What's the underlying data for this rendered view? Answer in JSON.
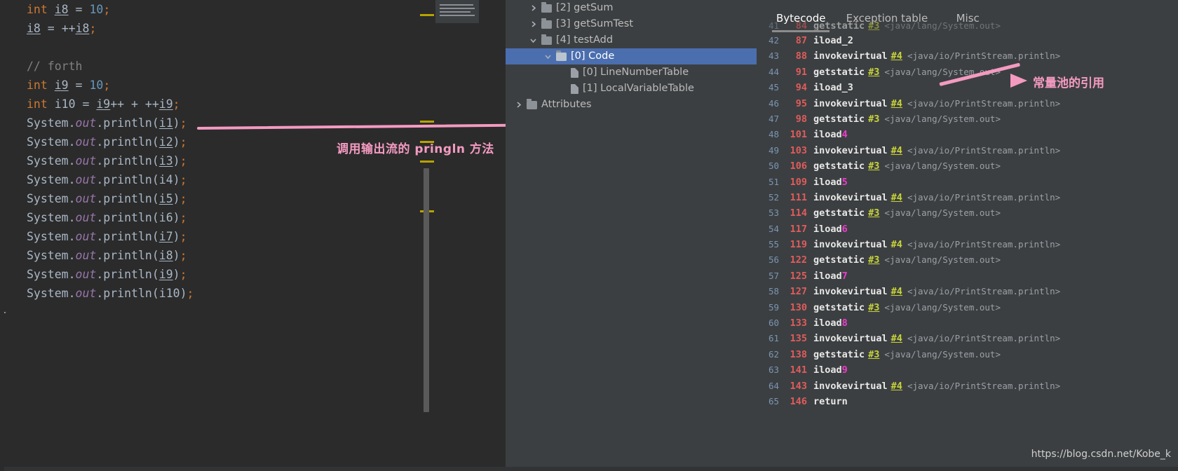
{
  "editor": {
    "lines": [
      {
        "indent": 2,
        "tokens": [
          {
            "t": "int",
            "c": "kw"
          },
          {
            "t": " ",
            "c": "var"
          },
          {
            "t": "i8",
            "c": "var u"
          },
          {
            "t": " = ",
            "c": "var"
          },
          {
            "t": "10",
            "c": "num"
          },
          {
            "t": ";",
            "c": "sc"
          }
        ]
      },
      {
        "indent": 2,
        "tokens": [
          {
            "t": "i8",
            "c": "var u"
          },
          {
            "t": " = ",
            "c": "var"
          },
          {
            "t": "++",
            "c": "var"
          },
          {
            "t": "i8",
            "c": "var u"
          },
          {
            "t": ";",
            "c": "sc"
          }
        ]
      },
      {
        "indent": 2,
        "tokens": []
      },
      {
        "indent": 2,
        "tokens": [
          {
            "t": "// forth",
            "c": "cmt"
          }
        ]
      },
      {
        "indent": 2,
        "tokens": [
          {
            "t": "int",
            "c": "kw"
          },
          {
            "t": " ",
            "c": "var"
          },
          {
            "t": "i9",
            "c": "var u"
          },
          {
            "t": " = ",
            "c": "var"
          },
          {
            "t": "10",
            "c": "num"
          },
          {
            "t": ";",
            "c": "sc"
          }
        ]
      },
      {
        "indent": 2,
        "tokens": [
          {
            "t": "int",
            "c": "kw"
          },
          {
            "t": " i10 = ",
            "c": "var"
          },
          {
            "t": "i9",
            "c": "var u"
          },
          {
            "t": "++ + ++",
            "c": "var"
          },
          {
            "t": "i9",
            "c": "var u"
          },
          {
            "t": ";",
            "c": "sc"
          }
        ]
      },
      {
        "indent": 2,
        "tokens": [
          {
            "t": "System.",
            "c": "var"
          },
          {
            "t": "out",
            "c": "fld"
          },
          {
            "t": ".println(",
            "c": "var"
          },
          {
            "t": "i1",
            "c": "var u"
          },
          {
            "t": ")",
            "c": "var"
          },
          {
            "t": ";",
            "c": "sc"
          }
        ]
      },
      {
        "indent": 2,
        "tokens": [
          {
            "t": "System.",
            "c": "var"
          },
          {
            "t": "out",
            "c": "fld"
          },
          {
            "t": ".println(",
            "c": "var"
          },
          {
            "t": "i2",
            "c": "var u"
          },
          {
            "t": ")",
            "c": "var"
          },
          {
            "t": ";",
            "c": "sc"
          }
        ]
      },
      {
        "indent": 2,
        "tokens": [
          {
            "t": "System.",
            "c": "var"
          },
          {
            "t": "out",
            "c": "fld"
          },
          {
            "t": ".println(",
            "c": "var"
          },
          {
            "t": "i3",
            "c": "var u"
          },
          {
            "t": ")",
            "c": "var"
          },
          {
            "t": ";",
            "c": "sc"
          }
        ]
      },
      {
        "indent": 2,
        "tokens": [
          {
            "t": "System.",
            "c": "var"
          },
          {
            "t": "out",
            "c": "fld"
          },
          {
            "t": ".println(",
            "c": "var"
          },
          {
            "t": "i4",
            "c": "var"
          },
          {
            "t": ")",
            "c": "var"
          },
          {
            "t": ";",
            "c": "sc"
          }
        ]
      },
      {
        "indent": 2,
        "tokens": [
          {
            "t": "System.",
            "c": "var"
          },
          {
            "t": "out",
            "c": "fld"
          },
          {
            "t": ".println(",
            "c": "var"
          },
          {
            "t": "i5",
            "c": "var u"
          },
          {
            "t": ")",
            "c": "var"
          },
          {
            "t": ";",
            "c": "sc"
          }
        ]
      },
      {
        "indent": 2,
        "tokens": [
          {
            "t": "System.",
            "c": "var"
          },
          {
            "t": "out",
            "c": "fld"
          },
          {
            "t": ".println(",
            "c": "var"
          },
          {
            "t": "i6",
            "c": "var"
          },
          {
            "t": ")",
            "c": "var"
          },
          {
            "t": ";",
            "c": "sc"
          }
        ]
      },
      {
        "indent": 2,
        "tokens": [
          {
            "t": "System.",
            "c": "var"
          },
          {
            "t": "out",
            "c": "fld"
          },
          {
            "t": ".println(",
            "c": "var"
          },
          {
            "t": "i7",
            "c": "var u"
          },
          {
            "t": ")",
            "c": "var"
          },
          {
            "t": ";",
            "c": "sc"
          }
        ]
      },
      {
        "indent": 2,
        "tokens": [
          {
            "t": "System.",
            "c": "var"
          },
          {
            "t": "out",
            "c": "fld"
          },
          {
            "t": ".println(",
            "c": "var"
          },
          {
            "t": "i8",
            "c": "var u"
          },
          {
            "t": ")",
            "c": "var"
          },
          {
            "t": ";",
            "c": "sc"
          }
        ]
      },
      {
        "indent": 2,
        "tokens": [
          {
            "t": "System.",
            "c": "var"
          },
          {
            "t": "out",
            "c": "fld"
          },
          {
            "t": ".println(",
            "c": "var"
          },
          {
            "t": "i9",
            "c": "var u"
          },
          {
            "t": ")",
            "c": "var"
          },
          {
            "t": ";",
            "c": "sc"
          }
        ]
      },
      {
        "indent": 2,
        "tokens": [
          {
            "t": "System.",
            "c": "var"
          },
          {
            "t": "out",
            "c": "fld"
          },
          {
            "t": ".println(i10)",
            "c": "var"
          },
          {
            "t": ";",
            "c": "sc"
          }
        ]
      },
      {
        "indent": 0,
        "tokens": [
          {
            "t": "}",
            "c": "brace"
          }
        ]
      }
    ],
    "plain_text": [
      "int i8 = 10;",
      "i8 = ++i8;",
      "",
      "// forth",
      "int i9 = 10;",
      "int i10 = i9++ + ++i9;",
      "System.out.println(i1);",
      "System.out.println(i2);",
      "System.out.println(i3);",
      "System.out.println(i4);",
      "System.out.println(i5);",
      "System.out.println(i6);",
      "System.out.println(i7);",
      "System.out.println(i8);",
      "System.out.println(i9);",
      "System.out.println(i10);",
      "}"
    ],
    "markers": [
      20,
      172,
      201,
      229,
      300
    ],
    "annotation": {
      "label": "调用输出流的 pringln 方法",
      "color": "#f49ac1"
    }
  },
  "tree": {
    "items": [
      {
        "label": "[2] getSum",
        "indent": 1,
        "chevron": "right",
        "icon": "folder-icon",
        "selected": false
      },
      {
        "label": "[3] getSumTest",
        "indent": 1,
        "chevron": "right",
        "icon": "folder-icon",
        "selected": false
      },
      {
        "label": "[4] testAdd",
        "indent": 1,
        "chevron": "down",
        "icon": "folder-icon",
        "selected": false
      },
      {
        "label": "[0] Code",
        "indent": 2,
        "chevron": "down",
        "icon": "folder-icon",
        "selected": true
      },
      {
        "label": "[0] LineNumberTable",
        "indent": 3,
        "chevron": "none",
        "icon": "file-icon",
        "selected": false
      },
      {
        "label": "[1] LocalVariableTable",
        "indent": 3,
        "chevron": "none",
        "icon": "file-icon",
        "selected": false
      },
      {
        "label": "Attributes",
        "indent": 0,
        "chevron": "right",
        "icon": "folder-icon",
        "selected": false
      }
    ]
  },
  "bytecode_panel": {
    "tabs": [
      {
        "label": "Bytecode",
        "active": true
      },
      {
        "label": "Exception table",
        "active": false
      },
      {
        "label": "Misc",
        "active": false
      }
    ],
    "annotation": {
      "label": "常量池的引用",
      "color": "#f49ac1"
    },
    "rows": [
      {
        "line": "42",
        "offset": "87",
        "op": "iload_2",
        "ref": "",
        "ref_underline": false,
        "comment": "",
        "arg": ""
      },
      {
        "line": "43",
        "offset": "88",
        "op": "invokevirtual",
        "ref": "#4",
        "ref_underline": true,
        "comment": "<java/io/PrintStream.println>",
        "arg": ""
      },
      {
        "line": "44",
        "offset": "91",
        "op": "getstatic",
        "ref": "#3",
        "ref_underline": true,
        "comment": "<java/lang/System.out>",
        "arg": ""
      },
      {
        "line": "45",
        "offset": "94",
        "op": "iload_3",
        "ref": "",
        "ref_underline": false,
        "comment": "",
        "arg": ""
      },
      {
        "line": "46",
        "offset": "95",
        "op": "invokevirtual",
        "ref": "#4",
        "ref_underline": true,
        "comment": "<java/io/PrintStream.println>",
        "arg": ""
      },
      {
        "line": "47",
        "offset": "98",
        "op": "getstatic",
        "ref": "#3",
        "ref_underline": false,
        "comment": "<java/lang/System.out>",
        "arg": ""
      },
      {
        "line": "48",
        "offset": "101",
        "op": "iload",
        "ref": "",
        "ref_underline": false,
        "comment": "",
        "arg": "4"
      },
      {
        "line": "49",
        "offset": "103",
        "op": "invokevirtual",
        "ref": "#4",
        "ref_underline": true,
        "comment": "<java/io/PrintStream.println>",
        "arg": ""
      },
      {
        "line": "50",
        "offset": "106",
        "op": "getstatic",
        "ref": "#3",
        "ref_underline": true,
        "comment": "<java/lang/System.out>",
        "arg": ""
      },
      {
        "line": "51",
        "offset": "109",
        "op": "iload",
        "ref": "",
        "ref_underline": false,
        "comment": "",
        "arg": "5"
      },
      {
        "line": "52",
        "offset": "111",
        "op": "invokevirtual",
        "ref": "#4",
        "ref_underline": true,
        "comment": "<java/io/PrintStream.println>",
        "arg": ""
      },
      {
        "line": "53",
        "offset": "114",
        "op": "getstatic",
        "ref": "#3",
        "ref_underline": true,
        "comment": "<java/lang/System.out>",
        "arg": ""
      },
      {
        "line": "54",
        "offset": "117",
        "op": "iload",
        "ref": "",
        "ref_underline": false,
        "comment": "",
        "arg": "6"
      },
      {
        "line": "55",
        "offset": "119",
        "op": "invokevirtual",
        "ref": "#4",
        "ref_underline": false,
        "comment": "<java/io/PrintStream.println>",
        "arg": ""
      },
      {
        "line": "56",
        "offset": "122",
        "op": "getstatic",
        "ref": "#3",
        "ref_underline": true,
        "comment": "<java/lang/System.out>",
        "arg": ""
      },
      {
        "line": "57",
        "offset": "125",
        "op": "iload",
        "ref": "",
        "ref_underline": false,
        "comment": "",
        "arg": "7"
      },
      {
        "line": "58",
        "offset": "127",
        "op": "invokevirtual",
        "ref": "#4",
        "ref_underline": true,
        "comment": "<java/io/PrintStream.println>",
        "arg": ""
      },
      {
        "line": "59",
        "offset": "130",
        "op": "getstatic",
        "ref": "#3",
        "ref_underline": true,
        "comment": "<java/lang/System.out>",
        "arg": ""
      },
      {
        "line": "60",
        "offset": "133",
        "op": "iload",
        "ref": "",
        "ref_underline": false,
        "comment": "",
        "arg": "8"
      },
      {
        "line": "61",
        "offset": "135",
        "op": "invokevirtual",
        "ref": "#4",
        "ref_underline": true,
        "comment": "<java/io/PrintStream.println>",
        "arg": ""
      },
      {
        "line": "62",
        "offset": "138",
        "op": "getstatic",
        "ref": "#3",
        "ref_underline": true,
        "comment": "<java/lang/System.out>",
        "arg": ""
      },
      {
        "line": "63",
        "offset": "141",
        "op": "iload",
        "ref": "",
        "ref_underline": false,
        "comment": "",
        "arg": "9"
      },
      {
        "line": "64",
        "offset": "143",
        "op": "invokevirtual",
        "ref": "#4",
        "ref_underline": true,
        "comment": "<java/io/PrintStream.println>",
        "arg": ""
      },
      {
        "line": "65",
        "offset": "146",
        "op": "return",
        "ref": "",
        "ref_underline": false,
        "comment": "",
        "arg": ""
      }
    ]
  },
  "watermark": {
    "text": "https://blog.csdn.net/Kobe_k"
  },
  "colors": {
    "editor_bg": "#2b2b2b",
    "panel_bg": "#3c3f41",
    "selection": "#4b6eaf",
    "annotation_pink": "#f49ac1",
    "marker_yellow": "#b8a200",
    "ref_yellow": "#c8d43a",
    "offset_red": "#e05c5c",
    "arg_magenta": "#ef3bd0"
  }
}
